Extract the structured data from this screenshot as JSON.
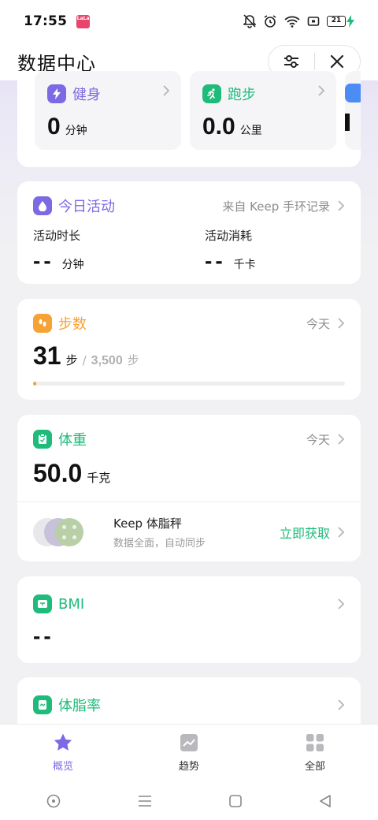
{
  "status_bar": {
    "time": "17:55",
    "app_badge": "LaLa",
    "battery": "21"
  },
  "header": {
    "title": "数据中心"
  },
  "top_cards": [
    {
      "title": "健身",
      "value": "0",
      "unit": "分钟",
      "color": "#7b6ae3",
      "icon": "lightning-icon"
    },
    {
      "title": "跑步",
      "value": "0.0",
      "unit": "公里",
      "color": "#1fbb7a",
      "icon": "running-icon"
    }
  ],
  "activity": {
    "title": "今日活动",
    "source": "来自 Keep 手环记录",
    "duration_label": "活动时长",
    "duration_value": "--",
    "duration_unit": "分钟",
    "burn_label": "活动消耗",
    "burn_value": "--",
    "burn_unit": "千卡",
    "color": "#7b6ae3"
  },
  "steps": {
    "title": "步数",
    "period": "今天",
    "value": "31",
    "unit": "步",
    "sep": "/",
    "goal": "3,500",
    "goal_unit": "步",
    "progress": 0.009,
    "color": "#f6a234"
  },
  "weight": {
    "title": "体重",
    "period": "今天",
    "value": "50.0",
    "unit": "千克",
    "color": "#1fbb7a",
    "promo_title": "Keep 体脂秤",
    "promo_sub": "数据全面，自动同步",
    "promo_action": "立即获取"
  },
  "bmi": {
    "title": "BMI",
    "value": "--",
    "color": "#1fbb7a"
  },
  "bodyfat": {
    "title": "体脂率",
    "color": "#1fbb7a"
  },
  "tabs": [
    {
      "label": "概览",
      "active": true
    },
    {
      "label": "趋势",
      "active": false
    },
    {
      "label": "全部",
      "active": false
    }
  ]
}
